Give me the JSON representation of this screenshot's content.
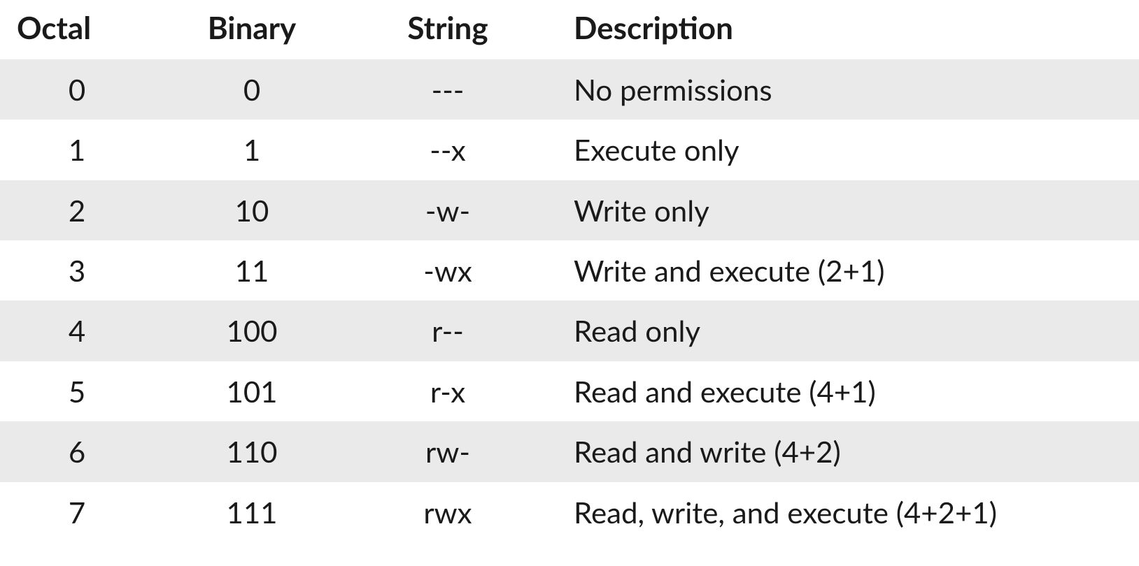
{
  "chart_data": {
    "type": "table",
    "columns": [
      "Octal",
      "Binary",
      "String",
      "Description"
    ],
    "rows": [
      [
        "0",
        "0",
        "---",
        "No permissions"
      ],
      [
        "1",
        "1",
        "--x",
        "Execute only"
      ],
      [
        "2",
        "10",
        "-w-",
        "Write only"
      ],
      [
        "3",
        "11",
        "-wx",
        "Write and execute (2+1)"
      ],
      [
        "4",
        "100",
        "r--",
        "Read only"
      ],
      [
        "5",
        "101",
        "r-x",
        "Read and execute (4+1)"
      ],
      [
        "6",
        "110",
        "rw-",
        "Read and write (4+2)"
      ],
      [
        "7",
        "111",
        "rwx",
        "Read, write, and execute (4+2+1)"
      ]
    ]
  },
  "table": {
    "headers": {
      "octal": "Octal",
      "binary": "Binary",
      "string": "String",
      "description": "Description"
    },
    "rows": [
      {
        "octal": "0",
        "binary": "0",
        "string": "---",
        "description": "No permissions"
      },
      {
        "octal": "1",
        "binary": "1",
        "string": "--x",
        "description": "Execute only"
      },
      {
        "octal": "2",
        "binary": "10",
        "string": "-w-",
        "description": "Write only"
      },
      {
        "octal": "3",
        "binary": "11",
        "string": "-wx",
        "description": "Write and execute (2+1)"
      },
      {
        "octal": "4",
        "binary": "100",
        "string": "r--",
        "description": "Read only"
      },
      {
        "octal": "5",
        "binary": "101",
        "string": "r-x",
        "description": "Read and execute (4+1)"
      },
      {
        "octal": "6",
        "binary": "110",
        "string": "rw-",
        "description": "Read and write (4+2)"
      },
      {
        "octal": "7",
        "binary": "111",
        "string": "rwx",
        "description": "Read, write, and execute (4+2+1)"
      }
    ]
  }
}
